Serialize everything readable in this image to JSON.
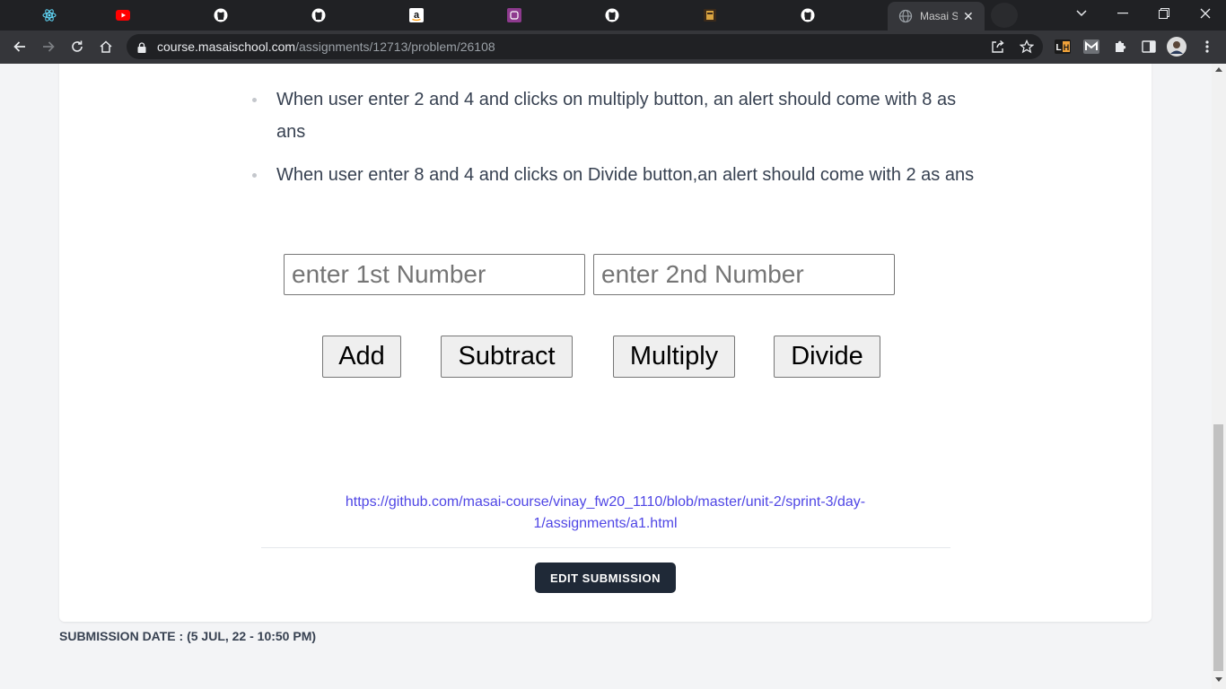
{
  "browser": {
    "active_tab_title": "Masai Sc",
    "url_host": "course.masaischool.com",
    "url_path": "/assignments/12713/problem/26108",
    "tab_icons": [
      "react-icon",
      "youtube-icon",
      "github-icon",
      "github-icon",
      "amazon-icon",
      "masai-icon",
      "github-icon",
      "book-icon",
      "github-icon"
    ],
    "extensions": [
      "leetcode-extension",
      "gmail-extension",
      "puzzle-extension"
    ]
  },
  "page": {
    "bullets": [
      "When user enter 2 and 4 and clicks on multiply button, an alert should come with 8 as ans",
      "When user enter 8 and 4 and clicks on Divide button,an alert should come with 2 as ans"
    ],
    "inputs": {
      "first_placeholder": "enter 1st Number",
      "second_placeholder": "enter 2nd Number"
    },
    "buttons": {
      "add": "Add",
      "subtract": "Subtract",
      "multiply": "Multiply",
      "divide": "Divide"
    },
    "submission_link": "https://github.com/masai-course/vinay_fw20_1110/blob/master/unit-2/sprint-3/day-1/assignments/a1.html",
    "edit_button": "EDIT SUBMISSION",
    "submission_date": "SUBMISSION DATE : (5 JUL, 22 - 10:50 PM)"
  },
  "colors": {
    "link": "#4f46e5",
    "edit_button_bg": "#1f2937",
    "page_bg": "#f3f4f6",
    "browser_dark": "#202124"
  }
}
